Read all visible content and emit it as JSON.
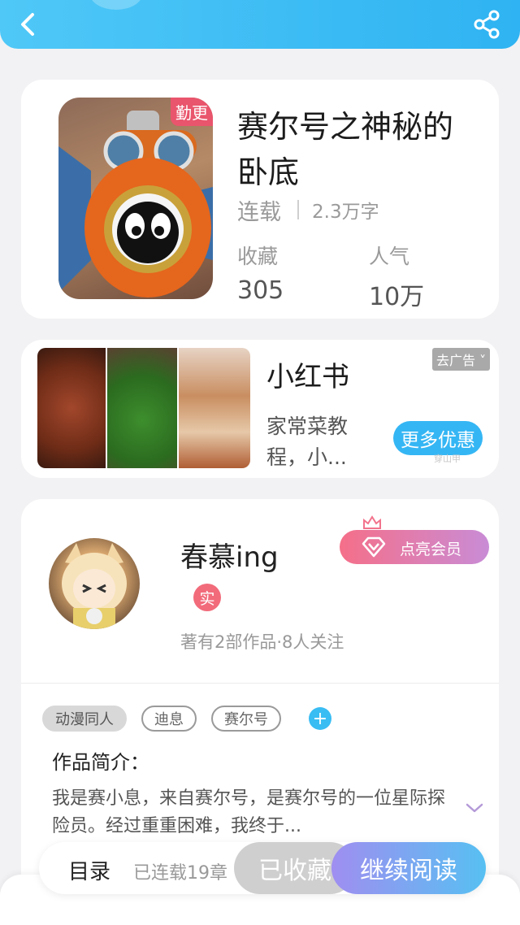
{
  "colors": {
    "accent": "#35b6f4",
    "header": "#2fb3f2",
    "vip_gradient_start": "#f56f89",
    "vip_gradient_end": "#c98cd6",
    "real_badge": "#f26b7b"
  },
  "header": {
    "back_icon": "chevron-left-icon",
    "share_icon": "share-icon"
  },
  "book": {
    "cover_tag": "勤更",
    "title": "赛尔号之神秘的卧底",
    "status": "连载",
    "words": "2.3万字",
    "favorites_label": "收藏",
    "favorites_value": "305",
    "popularity_label": "人气",
    "popularity_value": "10万"
  },
  "ad": {
    "badge": "去广告",
    "title": "小红书",
    "description": "家常菜教程，小...",
    "cta": "更多优惠",
    "source": "穿山甲"
  },
  "author": {
    "name": "春慕ing",
    "real_badge": "实",
    "stats": "著有2部作品·8人关注",
    "vip_button": "点亮会员"
  },
  "tags": [
    "动漫同人",
    "迪息",
    "赛尔号"
  ],
  "intro": {
    "title": "作品简介：",
    "text": "我是赛小息，来自赛尔号，是赛尔号的一位星际探险员。经过重重困难，我终于..."
  },
  "bottom": {
    "toc": "目录",
    "progress": "已连载19章",
    "collected": "已收藏",
    "continue": "继续阅读"
  }
}
